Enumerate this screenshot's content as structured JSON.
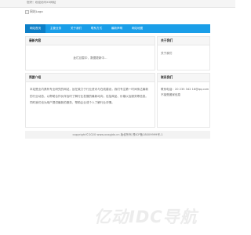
{
  "topbar": {
    "welcome": "您好！欢迎访问XX网站"
  },
  "logo": {
    "alt": "网站Logo"
  },
  "nav": [
    {
      "label": "网站首页",
      "active": true
    },
    {
      "label": "主营业务",
      "active": false
    },
    {
      "label": "关于我们",
      "active": false
    },
    {
      "label": "联系方式",
      "active": false
    },
    {
      "label": "最新声明",
      "active": false
    },
    {
      "label": "网站地图",
      "active": false
    }
  ],
  "latest": {
    "title": "最新内容",
    "text": "此栏目暂中，数据更新中..."
  },
  "about": {
    "title": "关于我们",
    "text": "关于我们"
  },
  "intro": {
    "title": "简要介绍",
    "text": "本站是业内具有专业研究的网站，旨在致力于行业资讯与在线建设，我们专注第一时间传达最新的行业动态，以帮助合作伙伴及时了解行业发展的最新动向，包括商品、价格以及服务等信息。同时我们也为用户提供最新的服务，帮助企业或个人了解行业详情。"
  },
  "contact": {
    "title": "联系我们",
    "lines": [
      "联系电话：20 235 342 18@qq.com",
      "不接受搬家信息"
    ]
  },
  "footer": {
    "text": "copyright©2020 www.xxxgjdx.cn 版权所有   豫ICP备18009999号-1"
  },
  "watermark": {
    "text": "亿动IDC导航"
  },
  "colors": {
    "nav_bg": "#1a9ee8",
    "nav_active": "#0d7fc7"
  }
}
